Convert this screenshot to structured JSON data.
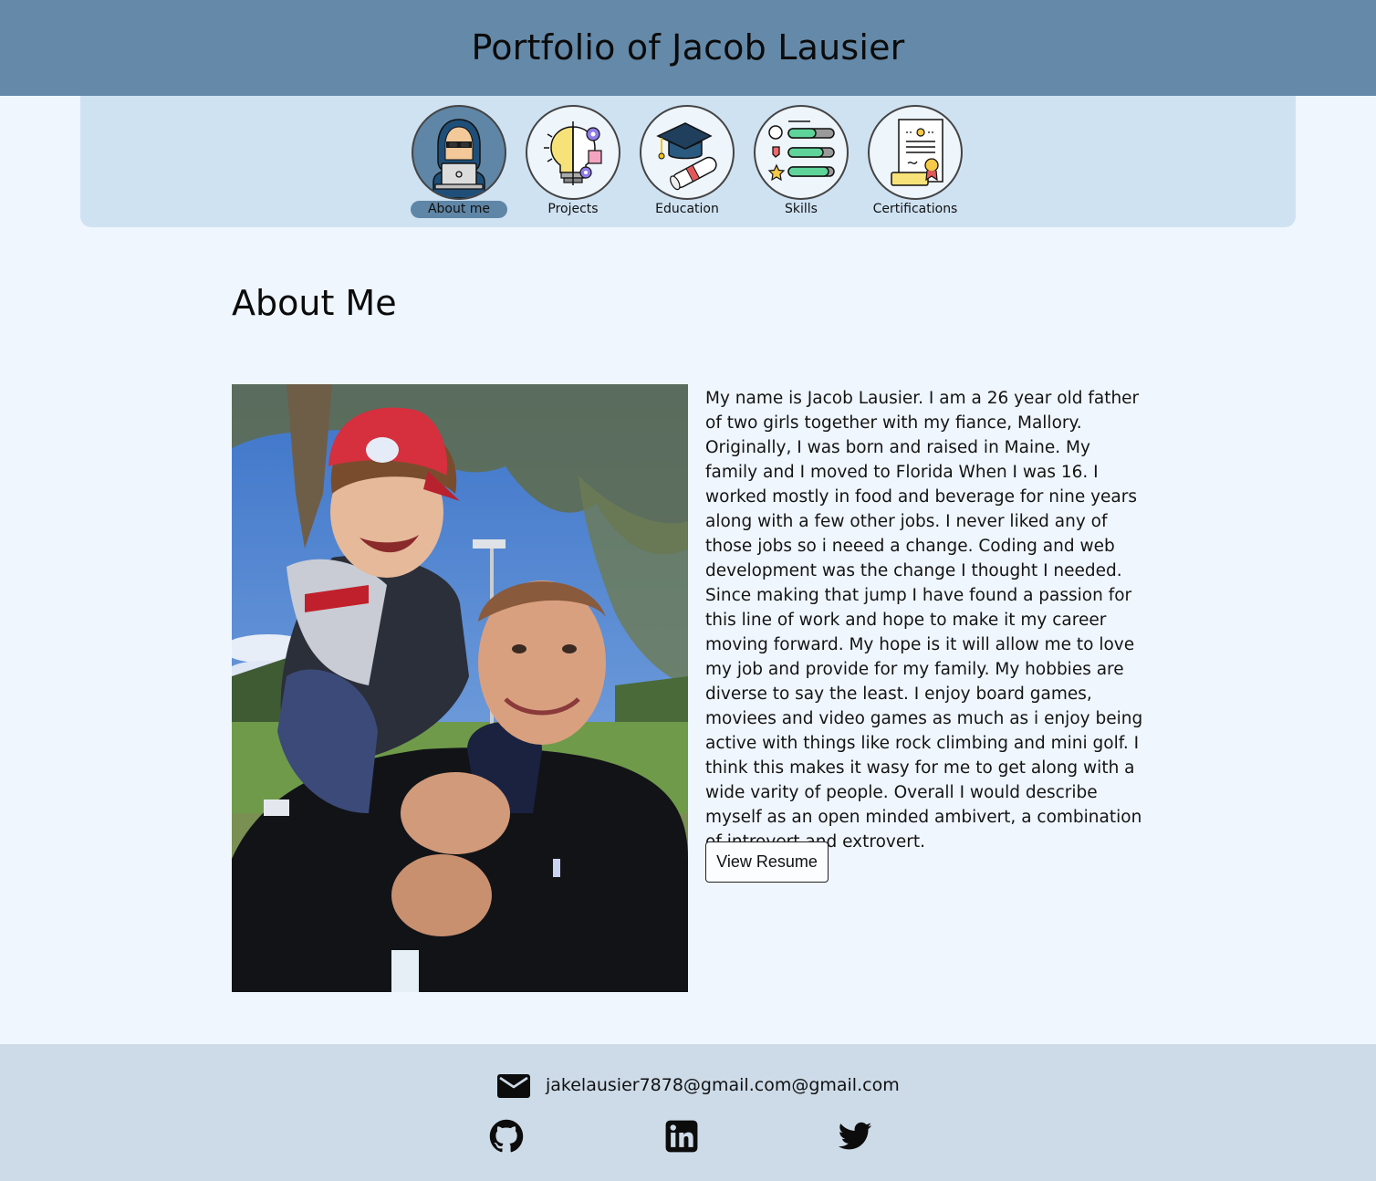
{
  "header": {
    "title": "Portfolio of Jacob Lausier"
  },
  "nav": {
    "items": [
      {
        "label": "About me",
        "icon": "hacker-laptop-icon",
        "active": true
      },
      {
        "label": "Projects",
        "icon": "lightbulb-gears-icon",
        "active": false
      },
      {
        "label": "Education",
        "icon": "graduation-cap-diploma-icon",
        "active": false
      },
      {
        "label": "Skills",
        "icon": "skill-bars-icon",
        "active": false
      },
      {
        "label": "Certifications",
        "icon": "certificate-icon",
        "active": false
      }
    ]
  },
  "main": {
    "title": "About Me",
    "photo_icon": "family-photo",
    "bio": "My name is Jacob Lausier. I am a 26 year old father of two girls together with my fiance, Mallory. Originally, I was born and raised in Maine. My family and I moved to Florida When I was 16. I worked mostly in food and beverage for nine years along with a few other jobs. I never liked any of those jobs so i neeed a change. Coding and web development was the change I thought I needed. Since making that jump I have found a passion for this line of work and hope to make it my career moving forward. My hope is it will allow me to love my job and provide for my family. My hobbies are diverse to say the least. I enjoy board games, moviees and video games as much as i enjoy being active with things like rock climbing and mini golf. I think this makes it wasy for me to get along with a wide varity of people. Overall I would describe myself as an open minded ambivert, a combination of introvert and extrovert.",
    "resume_button": "View Resume"
  },
  "footer": {
    "email": "jakelausier7878@gmail.com@gmail.com",
    "icons": [
      "mail-icon",
      "github-icon",
      "linkedin-icon",
      "twitter-icon"
    ]
  },
  "colors": {
    "header_bg": "#6589a8",
    "nav_bg": "#cfe2f2",
    "page_bg": "#eff6fd",
    "footer_bg": "#cddbe8",
    "active_accent": "#5f86a6"
  }
}
